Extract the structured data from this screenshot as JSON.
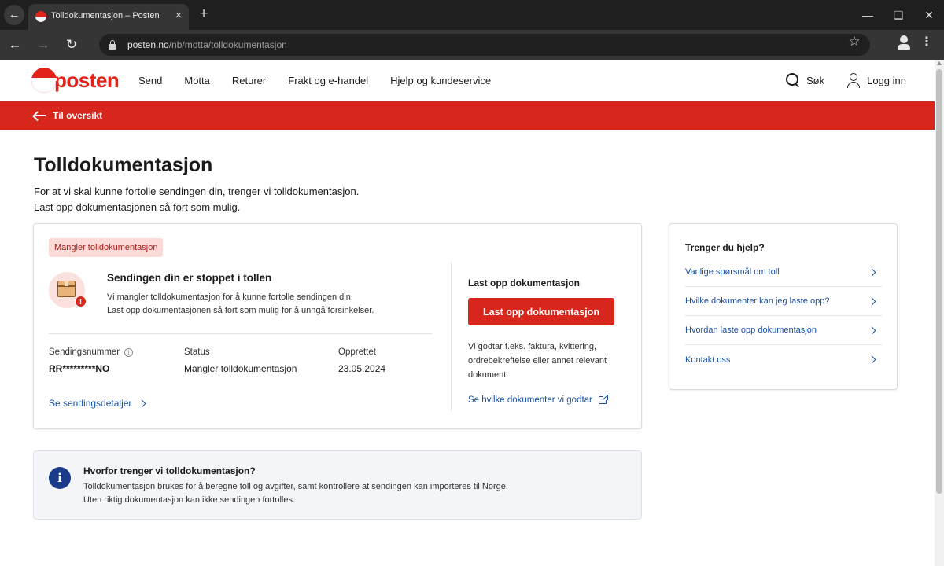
{
  "browser": {
    "tab_title": "Tolldokumentasjon – Posten",
    "url_host": "posten.no",
    "url_path": "/nb/motta/tolldokumentasjon"
  },
  "header": {
    "logo_text": "posten",
    "nav": [
      "Send",
      "Motta",
      "Returer",
      "Frakt og e-handel",
      "Hjelp og kundeservice"
    ],
    "search_label": "Søk",
    "login_label": "Logg inn"
  },
  "backbar": {
    "label": "Til oversikt"
  },
  "page": {
    "title": "Tolldokumentasjon",
    "intro_line1": "For at vi skal kunne fortolle sendingen din, trenger vi tolldokumentasjon.",
    "intro_line2": "Last opp dokumentasjonen så fort som mulig."
  },
  "card": {
    "badge": "Mangler tolldokumentasjon",
    "stop_title": "Sendingen din er stoppet i tollen",
    "stop_line1": "Vi mangler tolldokumentasjon for å kunne fortolle sendingen din.",
    "stop_line2": "Last opp dokumentasjonen så fort som mulig for å unngå forsinkelser.",
    "meta": {
      "tracking_label": "Sendingsnummer",
      "tracking_value": "RR*********NO",
      "status_label": "Status",
      "status_value": "Mangler tolldokumentasjon",
      "created_label": "Opprettet",
      "created_value": "23.05.2024"
    },
    "details_link": "Se sendingsdetaljer",
    "upload_heading": "Last opp dokumentasjon",
    "upload_button": "Last opp dokumentasjon",
    "accept_line1": "Vi godtar f.eks. faktura, kvittering,",
    "accept_line2": "ordrebekreftelse eller annet relevant",
    "accept_line3": "dokument.",
    "docs_link": "Se hvilke dokumenter vi godtar"
  },
  "help": {
    "title": "Trenger du hjelp?",
    "items": [
      "Vanlige spørsmål om toll",
      "Hvilke dokumenter kan jeg laste opp?",
      "Hvordan laste opp dokumentasjon",
      "Kontakt oss"
    ]
  },
  "info": {
    "title": "Hvorfor trenger vi tolldokumentasjon?",
    "line1": "Tolldokumentasjon brukes for å beregne toll og avgifter, samt kontrollere at sendingen kan importeres til Norge.",
    "line2": "Uten riktig dokumentasjon kan ikke sendingen fortolles."
  },
  "colors": {
    "brand_red": "#e2231a",
    "bar_red": "#d7261c",
    "link_blue": "#1a4fa0",
    "info_navy": "#1a3a8a"
  },
  "icons": [
    "back-arrow-icon",
    "favicon-icon",
    "close-icon",
    "plus-icon",
    "minimize-icon",
    "maximize-icon",
    "lock-icon",
    "star-icon",
    "profile-icon",
    "kebab-menu-icon",
    "search-icon",
    "user-icon",
    "arrow-left-icon",
    "package-icon",
    "alert-icon",
    "info-icon",
    "chevron-right-icon",
    "external-link-icon"
  ]
}
